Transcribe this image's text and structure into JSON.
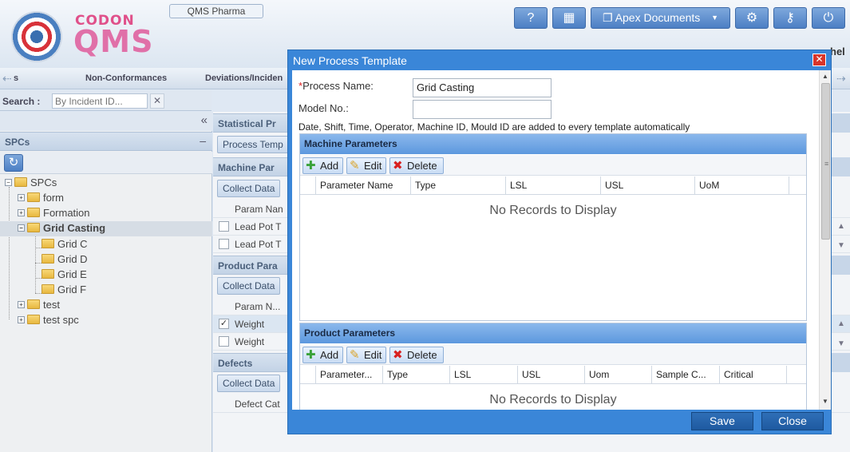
{
  "header": {
    "logo_top": "CODON",
    "logo_main": "QMS",
    "tenant": "QMS Pharma",
    "help_icon": "?",
    "apex_label": "Apex Documents",
    "user_fragment": "hel"
  },
  "nav": {
    "items": [
      "s",
      "Non-Conformances",
      "Deviations/Inciden"
    ]
  },
  "search": {
    "label": "Search :",
    "placeholder": "By Incident ID...",
    "clear": "✕"
  },
  "left_panel": {
    "collapse": "«",
    "title": "SPCs",
    "minus": "–",
    "tree": {
      "root": "SPCs",
      "items": [
        "form",
        "Formation",
        "Grid Casting",
        "Grid C",
        "Grid D",
        "Grid E",
        "Grid F",
        "test",
        "test spc"
      ]
    }
  },
  "mid_panel": {
    "sections": [
      "Statistical Pr",
      "Machine Par",
      "Product Para",
      "Defects"
    ],
    "process_temp": "Process Temp",
    "collect_data": "Collect Data",
    "param_name": "Param Nan",
    "lead_pot": "Lead Pot T",
    "param_n": "Param N...",
    "weight": "Weight",
    "defect_cat": "Defect Cat"
  },
  "modal": {
    "title": "New Process Template",
    "close": "✕",
    "process_name_label": "Process Name:",
    "required_mark": "*",
    "process_name_value": "Grid Casting",
    "model_no_label": "Model No.:",
    "model_no_value": "",
    "note": "Date, Shift, Time, Operator, Machine ID, Mould ID are added to every template automatically",
    "machine": {
      "title": "Machine Parameters",
      "buttons": {
        "add": "Add",
        "edit": "Edit",
        "delete": "Delete"
      },
      "columns": [
        "Parameter Name",
        "Type",
        "LSL",
        "USL",
        "UoM"
      ],
      "empty": "No Records to Display"
    },
    "product": {
      "title": "Product Parameters",
      "buttons": {
        "add": "Add",
        "edit": "Edit",
        "delete": "Delete"
      },
      "columns": [
        "Parameter...",
        "Type",
        "LSL",
        "USL",
        "Uom",
        "Sample C...",
        "Critical"
      ],
      "empty": "No Records to Display"
    },
    "save": "Save",
    "close_button": "Close"
  },
  "icons": {
    "add": "plus-icon",
    "edit": "pencil-icon",
    "delete": "x-icon",
    "refresh": "refresh-icon",
    "settings": "gear-icon",
    "search": "key-icon",
    "power": "power-icon",
    "calendar": "calendar-icon",
    "documents": "documents-icon"
  },
  "colors": {
    "modal_header": "#3a86d8",
    "section_header": "#5c98de",
    "primary_button": "#1e5aa0",
    "delete_red": "#d82020",
    "add_green": "#3aa23a"
  }
}
